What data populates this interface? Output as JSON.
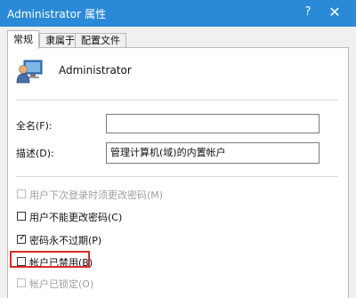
{
  "window": {
    "title": "Administrator 属性",
    "help_label": "?",
    "close_label": "✕"
  },
  "tabs": [
    {
      "label": "常规",
      "active": true
    },
    {
      "label": "隶属于",
      "active": false
    },
    {
      "label": "配置文件",
      "active": false
    }
  ],
  "user": {
    "name": "Administrator",
    "icon": "user-computer-icon"
  },
  "fields": {
    "full_name_label": "全名(F):",
    "full_name_value": "",
    "description_label": "描述(D):",
    "description_value": "管理计算机(域)的内置帐户"
  },
  "options": [
    {
      "label": "用户下次登录时须更改密码(M)",
      "checked": false,
      "disabled": true
    },
    {
      "label": "用户不能更改密码(C)",
      "checked": false,
      "disabled": false
    },
    {
      "label": "密码永不过期(P)",
      "checked": true,
      "disabled": false
    },
    {
      "label": "帐户已禁用(B)",
      "checked": false,
      "disabled": false
    },
    {
      "label": "帐户已锁定(O)",
      "checked": false,
      "disabled": true
    }
  ],
  "colors": {
    "titlebar": "#2b8ad8",
    "highlight": "#d92b2b"
  }
}
